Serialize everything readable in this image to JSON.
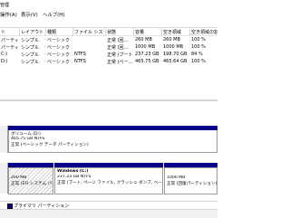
{
  "window": {
    "title": "管理"
  },
  "menu": {
    "items": [
      "操作(A)",
      "表示(V)",
      "ヘルプ(H)"
    ]
  },
  "volume_table": {
    "columns": [
      "ト",
      "レイアウト",
      "種類",
      "ファイル システム",
      "状態",
      "容量",
      "空き領域",
      "空き領域の割合"
    ],
    "rows": [
      [
        "パーティシ...",
        "シンプル",
        "ベーシック",
        "",
        "正常 (回...",
        "260 MB",
        "260 MB",
        "100 %"
      ],
      [
        "パーティシ...",
        "シンプル",
        "ベーシック",
        "",
        "正常 (回...",
        "1000 MB",
        "1000 MB",
        "100 %"
      ],
      [
        "C:)",
        "シンプル",
        "ベーシック",
        "NTFS",
        "正常 (ブート...",
        "237.23 GB",
        "198.70 GB",
        "84 %"
      ],
      [
        "D:)",
        "シンプル",
        "ベーシック",
        "NTFS",
        "正常 (ベー...",
        "465.75 GB",
        "465.64 GB",
        "100 %"
      ]
    ]
  },
  "graphical_view": {
    "disk1": {
      "volume_name": "ボリューム (D:)",
      "size_fs": "465.75 GB NTFS",
      "status": "正常 (ベーシック データ パーティション)"
    },
    "disk0": {
      "part1": {
        "size": "260 MB",
        "status": "正常 (EFI システム パーテ"
      },
      "part2": {
        "name": "Windows (C:)",
        "size_fs": "237.23 GB NTFS",
        "status": "正常 (ブート, ページ ファイル, クラッシュ ダンプ, ベーシック デー"
      },
      "part3": {
        "size": "1000 MB",
        "status": "正常 (回復パーティション)"
      }
    },
    "legend": {
      "primary_partition": "プライマリ パーティション"
    }
  },
  "colors": {
    "primary_partition": "#07008a",
    "hatch": "#cfcfcf"
  }
}
